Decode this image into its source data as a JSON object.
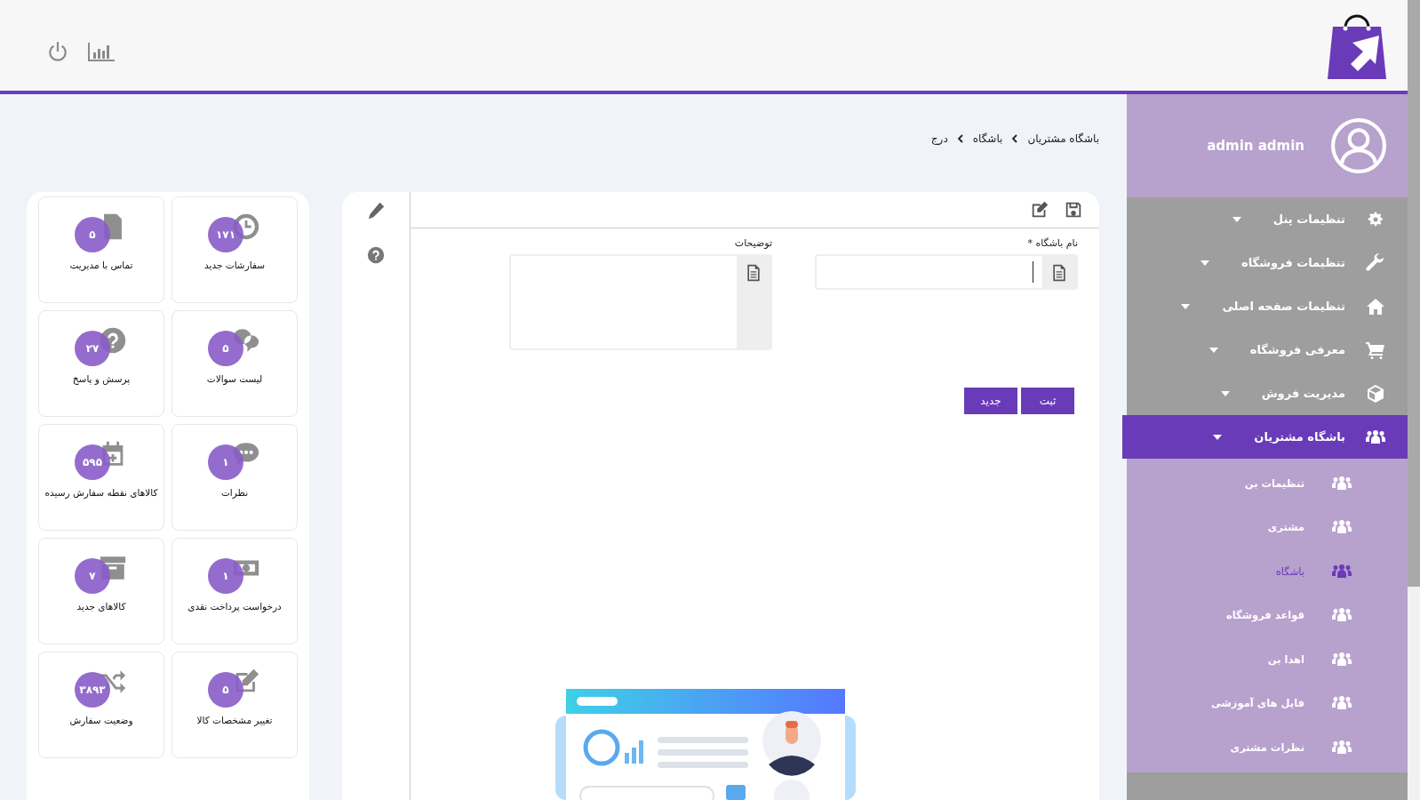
{
  "user": {
    "name": "admin admin"
  },
  "breadcrumb": [
    "باشگاه مشتریان",
    "باشگاه",
    "درج"
  ],
  "form": {
    "fields": [
      {
        "label": "نام باشگاه *",
        "kind": "input"
      },
      {
        "label": "توضیحات",
        "kind": "textarea"
      }
    ],
    "buttons": [
      "ثبت",
      "جدید"
    ]
  },
  "sidebar": {
    "items": [
      {
        "label": "تنظیمات پنل",
        "selected": false
      },
      {
        "label": "تنظیمات فروشگاه",
        "selected": false
      },
      {
        "label": "تنظیمات صفحه اصلی",
        "selected": false
      },
      {
        "label": "معرفی فروشگاه",
        "selected": false
      },
      {
        "label": "مدیریت فروش",
        "selected": false
      },
      {
        "label": "باشگاه مشتریان",
        "selected": true,
        "children": [
          {
            "label": "تنظیمات بن",
            "selected": false
          },
          {
            "label": "مشتری",
            "selected": false
          },
          {
            "label": "باشگاه",
            "selected": true
          },
          {
            "label": "قواعد فروشگاه",
            "selected": false
          },
          {
            "label": "اهدا بن",
            "selected": false
          },
          {
            "label": "فایل های آموزشی",
            "selected": false
          },
          {
            "label": "نظرات مشتری",
            "selected": false
          }
        ]
      }
    ]
  },
  "tiles": [
    {
      "label": "سفارشات جدید",
      "count": "۱۷۱"
    },
    {
      "label": "تماس با مدیریت",
      "count": "۵"
    },
    {
      "label": "لیست سوالات",
      "count": "۵"
    },
    {
      "label": "پرسش و پاسخ",
      "count": "۲۷"
    },
    {
      "label": "نظرات",
      "count": "۱"
    },
    {
      "label": "کالاهای نقطه سفارش رسیده",
      "count": "۵۹۵"
    },
    {
      "label": "درخواست پرداخت نقدی",
      "count": "۱"
    },
    {
      "label": "کالاهای جدید",
      "count": "۷"
    },
    {
      "label": "تغییر مشخصات کالا",
      "count": "۵"
    },
    {
      "label": "وضعیت سفارش",
      "count": "۳۸۹۳"
    }
  ]
}
